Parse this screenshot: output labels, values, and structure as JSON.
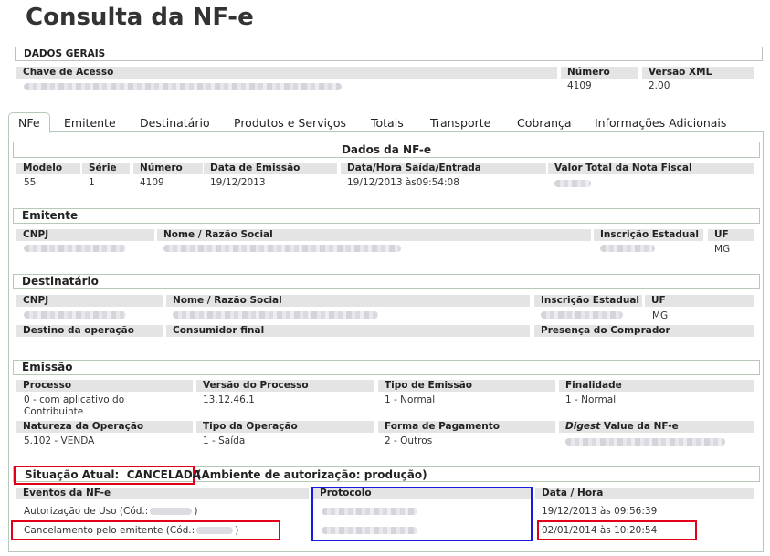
{
  "page": {
    "title": "Consulta da NF-e"
  },
  "geral": {
    "header": "DADOS GERAIS",
    "chave_label": "Chave de Acesso",
    "numero_label": "Número",
    "numero": "4109",
    "versao_label": "Versão XML",
    "versao": "2.00"
  },
  "tabs": [
    "NFe",
    "Emitente",
    "Destinatário",
    "Produtos e Serviços",
    "Totais",
    "Transporte",
    "Cobrança",
    "Informações Adicionais"
  ],
  "dados": {
    "header": "Dados da NF-e",
    "modelo_label": "Modelo",
    "modelo": "55",
    "serie_label": "Série",
    "serie": "1",
    "numero_label": "Número",
    "numero": "4109",
    "data_emissao_label": "Data de Emissão",
    "data_emissao": "19/12/2013",
    "saida_label": "Data/Hora Saída/Entrada",
    "saida": "19/12/2013 às09:54:08",
    "valor_label": "Valor Total da Nota Fiscal"
  },
  "emitente": {
    "header": "Emitente",
    "cnpj_label": "CNPJ",
    "nome_label": "Nome / Razão Social",
    "ie_label": "Inscrição Estadual",
    "uf_label": "UF",
    "uf": "MG"
  },
  "destinatario": {
    "header": "Destinatário",
    "cnpj_label": "CNPJ",
    "nome_label": "Nome / Razão Social",
    "ie_label": "Inscrição Estadual",
    "uf_label": "UF",
    "uf": "MG",
    "destino_label": "Destino da operação",
    "consumidor_label": "Consumidor final",
    "presenca_label": "Presença do Comprador"
  },
  "emissao": {
    "header": "Emissão",
    "processo_label": "Processo",
    "processo_line1": "0 - com aplicativo do",
    "processo_line2": "Contribuinte",
    "versao_label": "Versão do Processo",
    "versao": "13.12.46.1",
    "tipo_label": "Tipo de Emissão",
    "tipo": "1 - Normal",
    "finalidade_label": "Finalidade",
    "finalidade": "1 - Normal",
    "natureza_label": "Natureza da Operação",
    "natureza": "5.102 - VENDA",
    "tipo_op_label": "Tipo da Operação",
    "tipo_op": "1 - Saída",
    "pagamento_label": "Forma de Pagamento",
    "pagamento": "2 - Outros",
    "digest_em": "Digest",
    "digest_rest": " Value da NF-e"
  },
  "situacao": {
    "label": "Situação Atual:",
    "status": "CANCELADA",
    "ambiente": "(Ambiente de autorização: produção)",
    "eventos_label": "Eventos da NF-e",
    "protocolo_label": "Protocolo",
    "datahora_label": "Data / Hora",
    "events": [
      {
        "desc_pre": "Autorização de Uso (Cód.:",
        "desc_post": ")",
        "datahora": "19/12/2013 às 09:56:39"
      },
      {
        "desc_pre": "Cancelamento pelo emitente (Cód.:",
        "desc_post": ")",
        "datahora": "02/01/2014 às 10:20:54"
      }
    ]
  }
}
